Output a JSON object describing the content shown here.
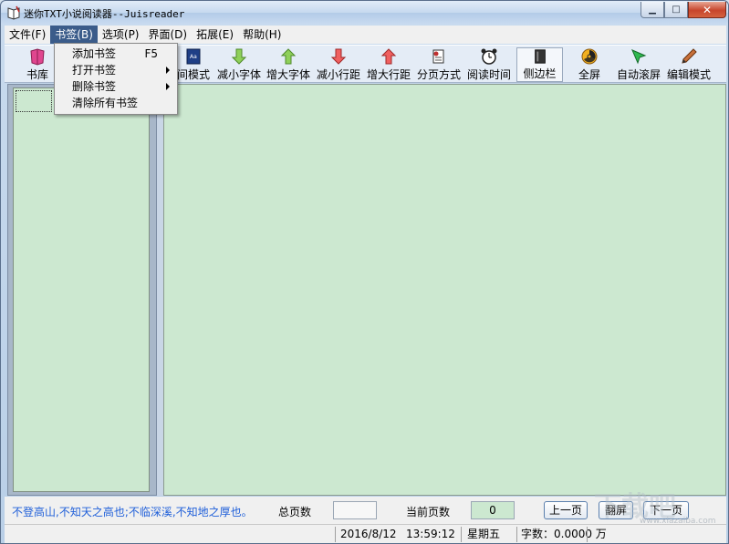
{
  "window": {
    "title": "迷你TXT小说阅读器--Juisreader",
    "controls": {
      "minimize": "▁",
      "maximize": "□",
      "close": "✕"
    }
  },
  "menubar": {
    "items": [
      {
        "label": "文件(F)"
      },
      {
        "label": "书签(B)"
      },
      {
        "label": "选项(P)"
      },
      {
        "label": "界面(D)"
      },
      {
        "label": "拓展(E)"
      },
      {
        "label": "帮助(H)"
      }
    ]
  },
  "bookmark_menu": {
    "items": [
      {
        "label": "添加书签",
        "shortcut": "F5"
      },
      {
        "label": "打开书签",
        "submenu": true
      },
      {
        "label": "删除书签",
        "submenu": true
      },
      {
        "label": "清除所有书签"
      }
    ]
  },
  "toolbar": {
    "buttons": [
      {
        "label": "书库",
        "icon": "bookshelf-icon",
        "color": "#d33a8a"
      },
      {
        "label": "间模式",
        "icon": "day-night-mode-icon",
        "color": "#2a4a8c"
      },
      {
        "label": "减小字体",
        "icon": "arrow-down-green-icon",
        "color": "#7cc24a"
      },
      {
        "label": "增大字体",
        "icon": "arrow-up-green-icon",
        "color": "#7cc24a"
      },
      {
        "label": "减小行距",
        "icon": "arrow-down-red-icon",
        "color": "#e04848"
      },
      {
        "label": "增大行距",
        "icon": "arrow-up-red-icon",
        "color": "#e04848"
      },
      {
        "label": "分页方式",
        "icon": "page-split-icon",
        "color": "#c03030"
      },
      {
        "label": "阅读时间",
        "icon": "alarm-clock-icon",
        "color": "#333333"
      },
      {
        "label": "侧边栏",
        "icon": "sidebar-book-icon",
        "color": "#444444"
      },
      {
        "label": "全屏",
        "icon": "fullscreen-icon",
        "color": "#e8a020"
      },
      {
        "label": "自动滚屏",
        "icon": "cursor-arrow-icon",
        "color": "#2aa84a"
      },
      {
        "label": "编辑模式",
        "icon": "pencil-icon",
        "color": "#b0562a"
      }
    ]
  },
  "status": {
    "quote": "不登高山,不知天之高也;不临深溪,不知地之厚也。",
    "total_pages_label": "总页数",
    "total_pages_value": "",
    "current_page_label": "当前页数",
    "current_page_value": "0",
    "prev_label": "上一页",
    "flip_label": "翻屏",
    "next_label": "下一页"
  },
  "statusbar": {
    "date": "2016/8/12",
    "time": "13:59:12",
    "weekday": "星期五",
    "word_count": "字数：0.0000 万"
  },
  "watermark": {
    "text": "下载吧",
    "sub": "www.xiazaiba.com"
  },
  "colors": {
    "reading_background": "#cce8d0",
    "quote_text": "#1f5fd9",
    "menu_active": "#3b5c8a"
  }
}
